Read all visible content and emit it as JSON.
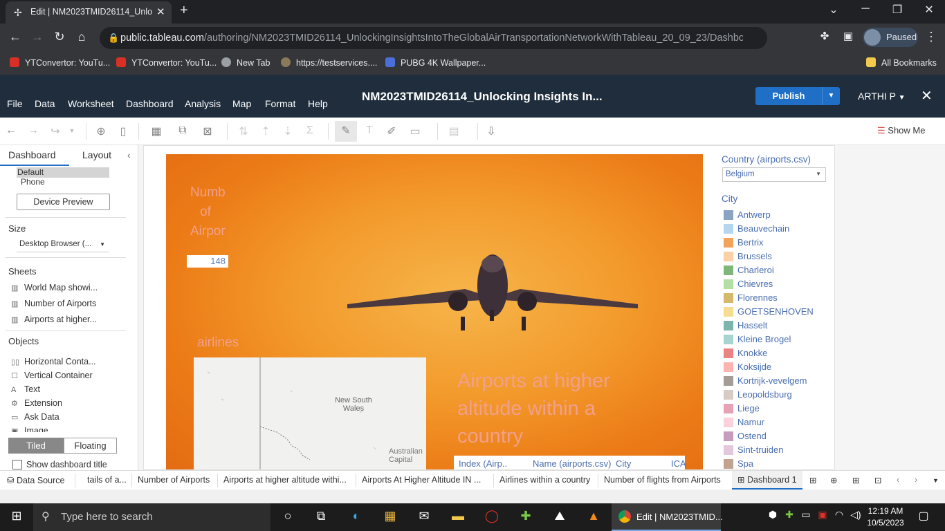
{
  "browser": {
    "tab_title": "Edit | NM2023TMID26114_Unloc",
    "url_domain": "public.tableau.com",
    "url_path": "/authoring/NM2023TMID26114_UnlockingInsightsIntoTheGlobalAirTransportationNetworkWithTableau_20_09_23/Dashboard...",
    "profile_status": "Paused",
    "bookmarks": [
      "YTConvertor: YouTu...",
      "YTConvertor: YouTu...",
      "New Tab",
      "https://testservices....",
      "PUBG 4K Wallpaper...",
      "All Bookmarks"
    ]
  },
  "tableau": {
    "menus": [
      "File",
      "Data",
      "Worksheet",
      "Dashboard",
      "Analysis",
      "Map",
      "Format",
      "Help"
    ],
    "workbook_title": "NM2023TMID26114_Unlocking Insights In...",
    "publish_label": "Publish",
    "user": "ARTHI P",
    "show_me": "Show Me"
  },
  "left_panel": {
    "tabs": [
      "Dashboard",
      "Layout"
    ],
    "device": {
      "default": "Default",
      "phone": "Phone",
      "preview_button": "Device Preview"
    },
    "size_heading": "Size",
    "size_value": "Desktop Browser (...",
    "sheets_heading": "Sheets",
    "sheets": [
      "World Map showi...",
      "Number of Airports",
      "Airports at higher..."
    ],
    "objects_heading": "Objects",
    "objects": [
      "Horizontal Conta...",
      "Vertical Container",
      "Text",
      "Extension",
      "Ask Data",
      "Image"
    ],
    "tiled": "Tiled",
    "floating": "Floating",
    "show_title": "Show dashboard title"
  },
  "dashboard": {
    "kpi_title_lines": [
      "Numb",
      "of",
      "Airpor"
    ],
    "kpi_value": "148",
    "airlines_title": "airlines",
    "map_labels": {
      "region": "New South Wales",
      "capital_line1": "Australian",
      "capital_line2": "Capital"
    },
    "altitude_title": "Airports at higher altitude within a country",
    "table_headers": [
      "Index (Airp..",
      "Name (airports.csv)",
      "City",
      "ICA"
    ],
    "filter_label": "Country (airports.csv)",
    "filter_value": "Belgium",
    "legend_title": "City",
    "legend": [
      {
        "name": "Antwerp",
        "color": "#8aa3c2"
      },
      {
        "name": "Beauvechain",
        "color": "#b6d6ef"
      },
      {
        "name": "Bertrix",
        "color": "#f3a35c"
      },
      {
        "name": "Brussels",
        "color": "#fcd0a5"
      },
      {
        "name": "Charleroi",
        "color": "#7fb77a"
      },
      {
        "name": "Chievres",
        "color": "#b3dfa7"
      },
      {
        "name": "Florennes",
        "color": "#d4b96b"
      },
      {
        "name": "GOETSENHOVEN",
        "color": "#f6dd92"
      },
      {
        "name": "Hasselt",
        "color": "#7eb4ae"
      },
      {
        "name": "Kleine Brogel",
        "color": "#a8d4cf"
      },
      {
        "name": "Knokke",
        "color": "#ea8484"
      },
      {
        "name": "Koksijde",
        "color": "#fbb4b1"
      },
      {
        "name": "Kortrijk-vevelgem",
        "color": "#a49c96"
      },
      {
        "name": "Leopoldsburg",
        "color": "#d6cbc5"
      },
      {
        "name": "Liege",
        "color": "#e8a2b6"
      },
      {
        "name": "Namur",
        "color": "#fbd1de"
      },
      {
        "name": "Ostend",
        "color": "#c79cbd"
      },
      {
        "name": "Sint-truiden",
        "color": "#e3c7dc"
      },
      {
        "name": "Spa",
        "color": "#c4a290"
      }
    ]
  },
  "sheet_tabs": [
    "Data Source",
    "tails of a...",
    "Number of Airports",
    "Airports at higher altitude withi...",
    "Airports At Higher Altitude IN ...",
    "Airlines within a country",
    "Number of flights from Airports",
    "Dashboard 1"
  ],
  "taskbar": {
    "search_placeholder": "Type here to search",
    "active_window": "Edit | NM2023TMID...",
    "time": "12:19 AM",
    "date": "10/5/2023"
  }
}
